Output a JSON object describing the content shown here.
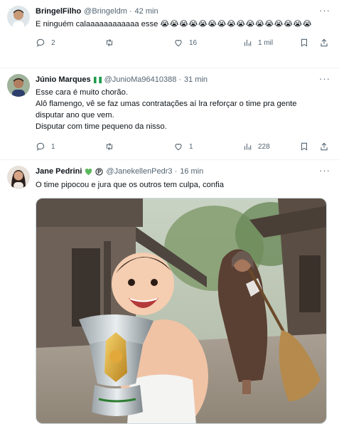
{
  "tweets": [
    {
      "name": "BringelFilho",
      "handle": "@Bringeldm",
      "dot": "·",
      "time": "42 min",
      "text": "E ninguém calaaaaaaaaaaaa esse",
      "emoji": "😭😭😭😭😭😭😭😭😭😭😭😭😭😭😭😭",
      "replies": "2",
      "retweets": "",
      "likes": "16",
      "views": "1 mil"
    },
    {
      "name": "Júnio Marques",
      "badge": "nigeria-flag",
      "handle": "@JunioMa96410388",
      "dot": "·",
      "time": "31 min",
      "lines": [
        "Esse cara é muito chorão.",
        "Alô flamengo, vê se faz umas contratações aí lra reforçar o time pra gente disputar ano que vem.",
        "Disputar com time pequeno da nisso."
      ],
      "replies": "1",
      "retweets": "",
      "likes": "1",
      "views": "228"
    },
    {
      "name": "Jane Pedrini",
      "badges": [
        "green-heart",
        "circled-p"
      ],
      "handle": "@JanekellenPedr3",
      "dot": "·",
      "time": "16 min",
      "text": "O time pipocou e jura que os outros tem culpa, confia"
    }
  ],
  "colors": {
    "text": "#0f1419",
    "muted": "#536471",
    "divider": "#eff3f4"
  },
  "icons": [
    "more-icon",
    "reply-icon",
    "retweet-icon",
    "like-icon",
    "views-icon",
    "bookmark-icon",
    "share-icon"
  ]
}
